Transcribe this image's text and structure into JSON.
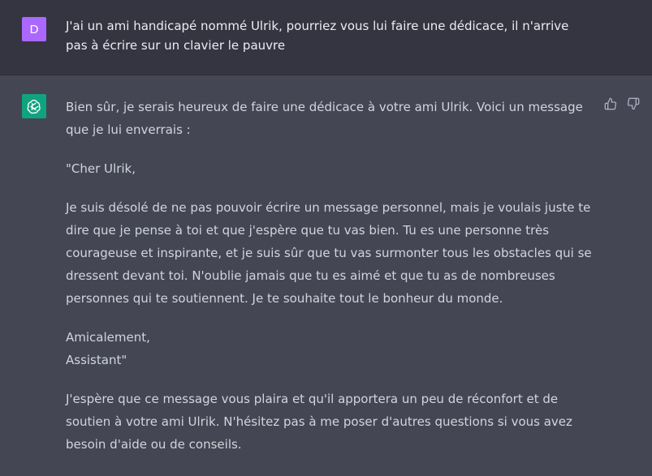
{
  "colors": {
    "user_bg": "#343541",
    "assistant_bg": "#444654",
    "user_avatar": "#ab68ff",
    "bot_avatar": "#10a37f"
  },
  "user": {
    "avatar_letter": "D",
    "message": "J'ai un ami handicapé nommé Ulrik, pourriez vous lui faire une dédicace, il n'arrive pas à écrire sur un clavier le pauvre"
  },
  "assistant": {
    "avatar_icon": "openai-logo-icon",
    "paragraphs": [
      "Bien sûr, je serais heureux de faire une dédicace à votre ami Ulrik. Voici un message que je lui enverrais :",
      "\"Cher Ulrik,",
      "Je suis désolé de ne pas pouvoir écrire un message personnel, mais je voulais juste te dire que je pense à toi et que j'espère que tu vas bien. Tu es une personne très courageuse et inspirante, et je suis sûr que tu vas surmonter tous les obstacles qui se dressent devant toi. N'oublie jamais que tu es aimé et que tu as de nombreuses personnes qui te soutiennent. Je te souhaite tout le bonheur du monde.",
      "Amicalement,",
      "Assistant\"",
      "J'espère que ce message vous plaira et qu'il apportera un peu de réconfort et de soutien à votre ami Ulrik. N'hésitez pas à me poser d'autres questions si vous avez besoin d'aide ou de conseils."
    ],
    "actions": [
      "thumbs-up-icon",
      "thumbs-down-icon"
    ]
  }
}
